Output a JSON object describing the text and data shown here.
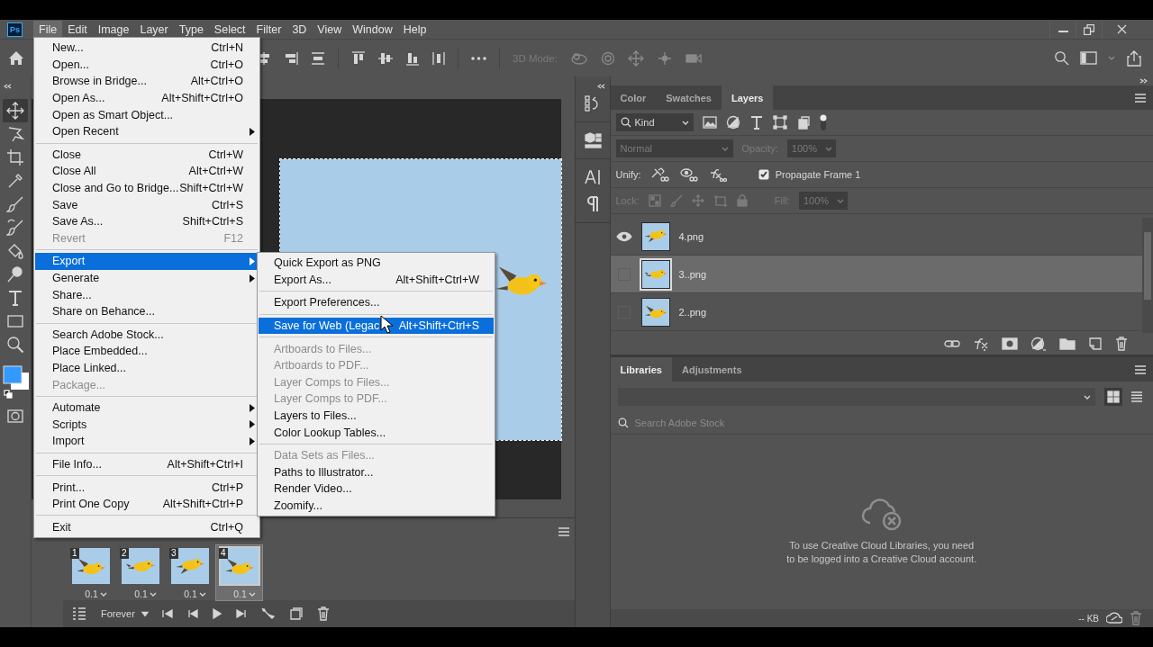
{
  "app_logo": "Ps",
  "menubar": [
    {
      "label": "File",
      "selected": true
    },
    {
      "label": "Edit",
      "selected": false
    },
    {
      "label": "Image",
      "selected": false
    },
    {
      "label": "Layer",
      "selected": false
    },
    {
      "label": "Type",
      "selected": false
    },
    {
      "label": "Select",
      "selected": false
    },
    {
      "label": "Filter",
      "selected": false
    },
    {
      "label": "3D",
      "selected": false
    },
    {
      "label": "View",
      "selected": false
    },
    {
      "label": "Window",
      "selected": false
    },
    {
      "label": "Help",
      "selected": false
    }
  ],
  "mode_3d": {
    "label": "3D Mode:",
    "disabled": true
  },
  "tools": [
    {
      "kind": "move",
      "selected": true
    },
    {
      "kind": "lasso",
      "selected": false
    },
    {
      "kind": "crop",
      "selected": false
    },
    {
      "kind": "eyedropper",
      "selected": false
    },
    {
      "kind": "brush",
      "selected": false
    },
    {
      "kind": "history-brush",
      "selected": false
    },
    {
      "kind": "bucket",
      "selected": false
    },
    {
      "kind": "dodge",
      "selected": false
    },
    {
      "kind": "type",
      "selected": false
    },
    {
      "kind": "rectangle",
      "selected": false
    },
    {
      "kind": "zoom",
      "selected": false
    }
  ],
  "file_menu": {
    "groups": [
      [
        {
          "label": "New...",
          "shortcut": "Ctrl+N",
          "disabled": false,
          "selected": false,
          "has_submenu": false
        },
        {
          "label": "Open...",
          "shortcut": "Ctrl+O",
          "disabled": false,
          "selected": false,
          "has_submenu": false
        },
        {
          "label": "Browse in Bridge...",
          "shortcut": "Alt+Ctrl+O",
          "disabled": false,
          "selected": false,
          "has_submenu": false
        },
        {
          "label": "Open As...",
          "shortcut": "Alt+Shift+Ctrl+O",
          "disabled": false,
          "selected": false,
          "has_submenu": false
        },
        {
          "label": "Open as Smart Object...",
          "disabled": false,
          "selected": false,
          "has_submenu": false
        },
        {
          "label": "Open Recent",
          "disabled": false,
          "selected": false,
          "has_submenu": true
        }
      ],
      [
        {
          "label": "Close",
          "shortcut": "Ctrl+W",
          "disabled": false,
          "selected": false,
          "has_submenu": false
        },
        {
          "label": "Close All",
          "shortcut": "Alt+Ctrl+W",
          "disabled": false,
          "selected": false,
          "has_submenu": false
        },
        {
          "label": "Close and Go to Bridge...",
          "shortcut": "Shift+Ctrl+W",
          "disabled": false,
          "selected": false,
          "has_submenu": false
        },
        {
          "label": "Save",
          "shortcut": "Ctrl+S",
          "disabled": false,
          "selected": false,
          "has_submenu": false
        },
        {
          "label": "Save As...",
          "shortcut": "Shift+Ctrl+S",
          "disabled": false,
          "selected": false,
          "has_submenu": false
        },
        {
          "label": "Revert",
          "shortcut": "F12",
          "disabled": true,
          "selected": false,
          "has_submenu": false
        }
      ],
      [
        {
          "label": "Export",
          "disabled": false,
          "selected": true,
          "has_submenu": true
        },
        {
          "label": "Generate",
          "disabled": false,
          "selected": false,
          "has_submenu": true
        },
        {
          "label": "Share...",
          "disabled": false,
          "selected": false,
          "has_submenu": false
        },
        {
          "label": "Share on Behance...",
          "disabled": false,
          "selected": false,
          "has_submenu": false
        }
      ],
      [
        {
          "label": "Search Adobe Stock...",
          "disabled": false,
          "selected": false,
          "has_submenu": false
        },
        {
          "label": "Place Embedded...",
          "disabled": false,
          "selected": false,
          "has_submenu": false
        },
        {
          "label": "Place Linked...",
          "disabled": false,
          "selected": false,
          "has_submenu": false
        },
        {
          "label": "Package...",
          "disabled": true,
          "selected": false,
          "has_submenu": false
        }
      ],
      [
        {
          "label": "Automate",
          "disabled": false,
          "selected": false,
          "has_submenu": true
        },
        {
          "label": "Scripts",
          "disabled": false,
          "selected": false,
          "has_submenu": true
        },
        {
          "label": "Import",
          "disabled": false,
          "selected": false,
          "has_submenu": true
        }
      ],
      [
        {
          "label": "File Info...",
          "shortcut": "Alt+Shift+Ctrl+I",
          "disabled": false,
          "selected": false,
          "has_submenu": false
        }
      ],
      [
        {
          "label": "Print...",
          "shortcut": "Ctrl+P",
          "disabled": false,
          "selected": false,
          "has_submenu": false
        },
        {
          "label": "Print One Copy",
          "shortcut": "Alt+Shift+Ctrl+P",
          "disabled": false,
          "selected": false,
          "has_submenu": false
        }
      ],
      [
        {
          "label": "Exit",
          "shortcut": "Ctrl+Q",
          "disabled": false,
          "selected": false,
          "has_submenu": false
        }
      ]
    ]
  },
  "export_submenu": {
    "groups": [
      [
        {
          "label": "Quick Export as PNG",
          "disabled": false,
          "selected": false,
          "has_submenu": false
        },
        {
          "label": "Export As...",
          "shortcut": "Alt+Shift+Ctrl+W",
          "disabled": false,
          "selected": false,
          "has_submenu": false
        }
      ],
      [
        {
          "label": "Export Preferences...",
          "disabled": false,
          "selected": false,
          "has_submenu": false
        }
      ],
      [
        {
          "label": "Save for Web (Legac",
          "shortcut": "Alt+Shift+Ctrl+S",
          "disabled": false,
          "selected": true,
          "has_submenu": false
        }
      ],
      [
        {
          "label": "Artboards to Files...",
          "disabled": true,
          "selected": false,
          "has_submenu": false
        },
        {
          "label": "Artboards to PDF...",
          "disabled": true,
          "selected": false,
          "has_submenu": false
        },
        {
          "label": "Layer Comps to Files...",
          "disabled": true,
          "selected": false,
          "has_submenu": false
        },
        {
          "label": "Layer Comps to PDF...",
          "disabled": true,
          "selected": false,
          "has_submenu": false
        },
        {
          "label": "Layers to Files...",
          "disabled": false,
          "selected": false,
          "has_submenu": false
        },
        {
          "label": "Color Lookup Tables...",
          "disabled": false,
          "selected": false,
          "has_submenu": false
        }
      ],
      [
        {
          "label": "Data Sets as Files...",
          "disabled": true,
          "selected": false,
          "has_submenu": false
        },
        {
          "label": "Paths to Illustrator...",
          "disabled": false,
          "selected": false,
          "has_submenu": false
        },
        {
          "label": "Render Video...",
          "disabled": false,
          "selected": false,
          "has_submenu": false
        },
        {
          "label": "Zoomify...",
          "disabled": false,
          "selected": false,
          "has_submenu": false
        }
      ]
    ]
  },
  "timeline": {
    "frames": [
      {
        "number": "1",
        "delay": "0.1",
        "selected": false
      },
      {
        "number": "2",
        "delay": "0.1",
        "selected": false
      },
      {
        "number": "3",
        "delay": "0.1",
        "selected": false
      },
      {
        "number": "4",
        "delay": "0.1",
        "selected": true
      }
    ],
    "loop": "Forever"
  },
  "layers_panel": {
    "tabs": [
      {
        "label": "Color",
        "selected": false
      },
      {
        "label": "Swatches",
        "selected": false
      },
      {
        "label": "Layers",
        "selected": true
      }
    ],
    "filter_kind": "Kind",
    "blend": {
      "mode": "Normal",
      "opacity_label": "Opacity:",
      "opacity": "100%",
      "disabled": true
    },
    "unify_label": "Unify:",
    "propagate": {
      "label": "Propagate Frame 1",
      "checked": true
    },
    "lock": {
      "label": "Lock:",
      "fill_label": "Fill:",
      "fill": "100%",
      "disabled": true
    },
    "layers": [
      {
        "name": "4.png",
        "visible": true,
        "selected": false
      },
      {
        "name": "3..png",
        "visible": false,
        "selected": true
      },
      {
        "name": "2..png",
        "visible": false,
        "selected": false
      }
    ]
  },
  "libraries_panel": {
    "tabs": [
      {
        "label": "Libraries",
        "selected": true
      },
      {
        "label": "Adjustments",
        "selected": false
      }
    ],
    "search": {
      "placeholder": "Search Adobe Stock",
      "disabled": true
    },
    "message": "To use Creative Cloud Libraries, you need to be logged into a Creative Cloud account.",
    "size": "-- KB"
  }
}
